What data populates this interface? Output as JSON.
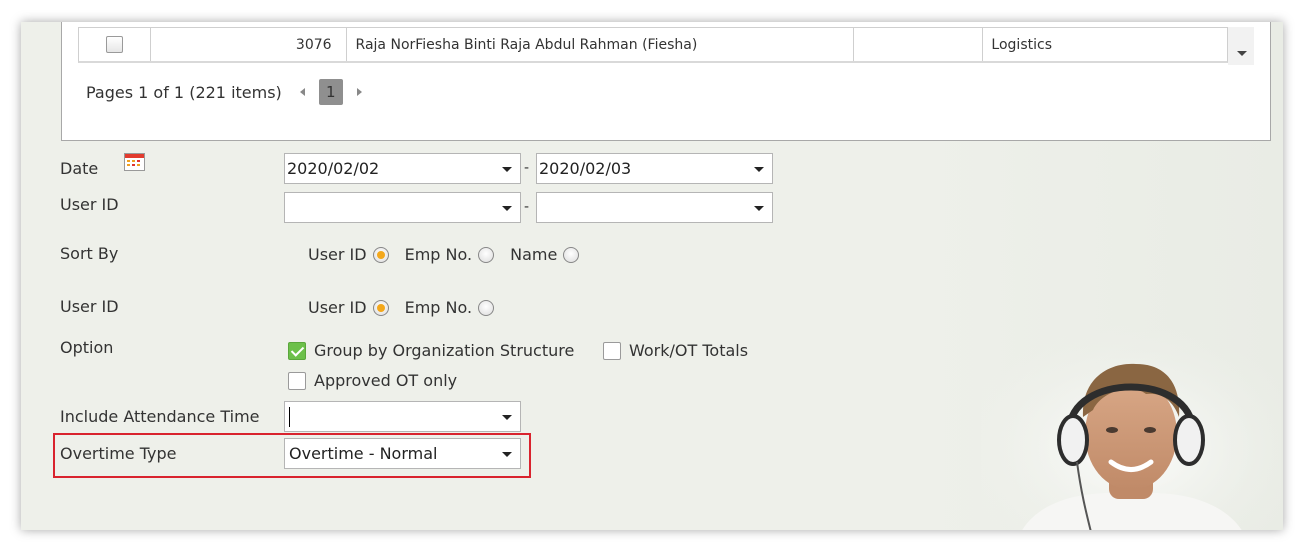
{
  "grid": {
    "row": {
      "id": "3076",
      "name": "Raja NorFiesha Binti Raja Abdul Rahman (Fiesha)",
      "col4": "",
      "department": "Logistics"
    },
    "pager": {
      "summary": "Pages 1 of 1 (221 items)",
      "current_page": "1"
    }
  },
  "form": {
    "date": {
      "label": "Date",
      "from": "2020/02/02",
      "to": "2020/02/03",
      "separator": "-",
      "icon": "calendar-icon"
    },
    "user_id_range": {
      "label": "User ID",
      "from": "",
      "to": "",
      "separator": "-"
    },
    "sort_by": {
      "label": "Sort By",
      "options": [
        {
          "label": "User ID",
          "selected": true
        },
        {
          "label": "Emp No.",
          "selected": false
        },
        {
          "label": "Name",
          "selected": false
        }
      ]
    },
    "user_id_display": {
      "label": "User ID",
      "options": [
        {
          "label": "User ID",
          "selected": true
        },
        {
          "label": "Emp No.",
          "selected": false
        }
      ]
    },
    "option": {
      "label": "Option",
      "group_by_org": {
        "label": "Group by Organization Structure",
        "checked": true
      },
      "work_ot_totals": {
        "label": "Work/OT Totals",
        "checked": false
      },
      "approved_ot_only": {
        "label": "Approved OT only",
        "checked": false
      }
    },
    "include_attendance_time": {
      "label": "Include Attendance Time",
      "value": ""
    },
    "overtime_type": {
      "label": "Overtime Type",
      "value": "Overtime - Normal"
    }
  },
  "colors": {
    "panel_bg": "#eef0ea",
    "highlight_border": "#d9232e",
    "radio_selected": "#f3a81c",
    "checkbox_checked": "#6cc04a"
  }
}
